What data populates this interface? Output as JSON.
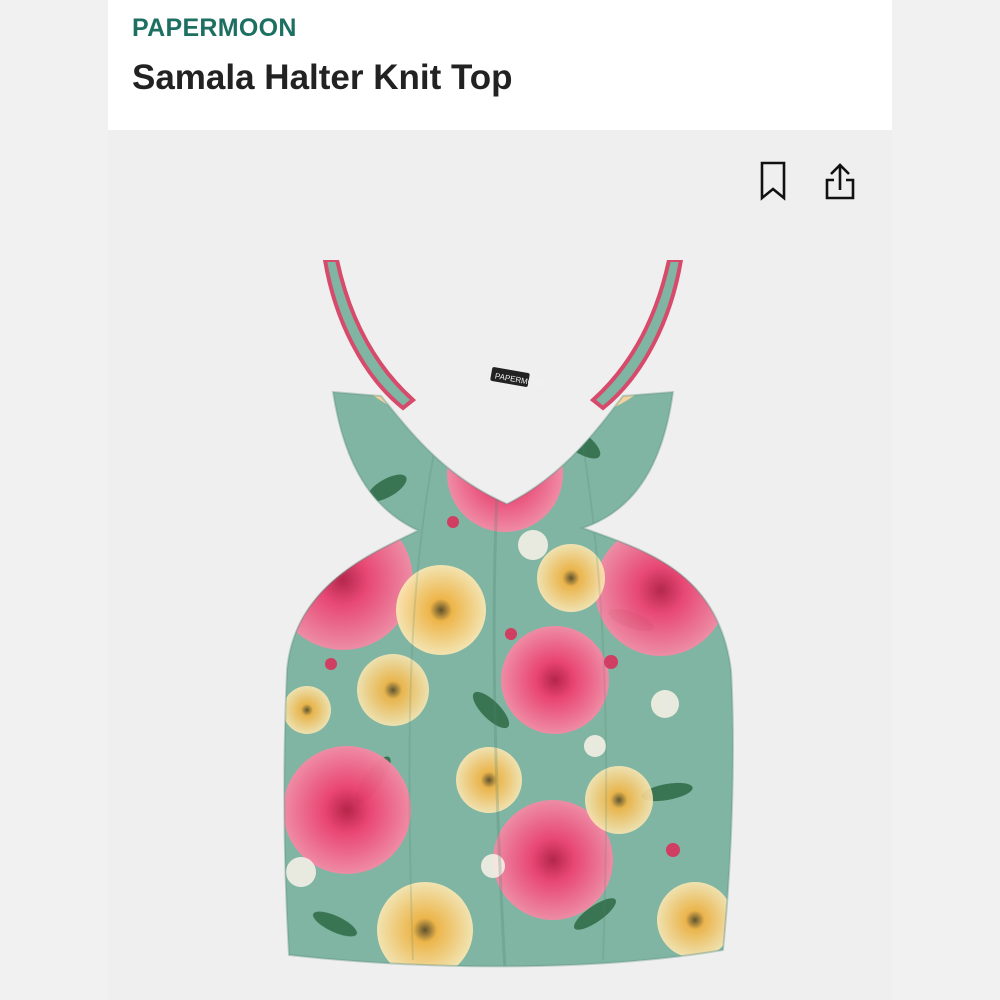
{
  "product": {
    "brand": "PAPERMOON",
    "title": "Samala Halter Knit Top"
  },
  "actions": {
    "bookmark_icon": "bookmark-icon",
    "share_icon": "share-icon"
  },
  "image": {
    "alt": "Samala Halter Knit Top floral print",
    "label_text": "PAPERMOON"
  },
  "colors": {
    "brand": "#1d6f62",
    "title": "#222222",
    "background": "#efefef",
    "fabric_base": "#7fb5a2",
    "flower_pink": "#ef3f70",
    "flower_yellow": "#f4b545"
  }
}
